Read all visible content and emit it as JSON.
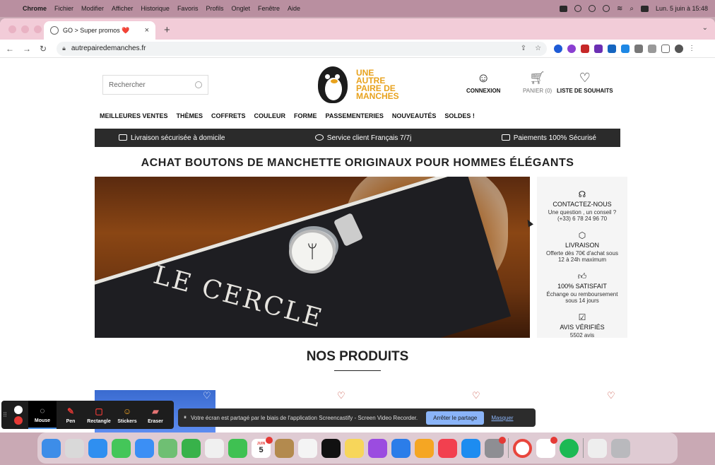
{
  "menubar": {
    "app": "Chrome",
    "items": [
      "Fichier",
      "Modifier",
      "Afficher",
      "Historique",
      "Favoris",
      "Profils",
      "Onglet",
      "Fenêtre",
      "Aide"
    ],
    "clock": "Lun. 5 juin à 15:48"
  },
  "browser": {
    "tab_title": "GO > Super promos ❤️",
    "url": "autrepairedemanches.fr",
    "new_tab": "+",
    "close": "×"
  },
  "site": {
    "search_placeholder": "Rechercher",
    "logo_text": "UNE AUTRE PAIRE DE MANCHES",
    "login": "CONNEXION",
    "cart": "PANIER (0)",
    "wishlist": "LISTE DE SOUHAITS",
    "menu": [
      "MEILLEURES VENTES",
      "THÈMES",
      "COFFRETS",
      "COULEUR",
      "FORME",
      "PASSEMENTERIES",
      "NOUVEAUTÉS",
      "SOLDES !"
    ],
    "banner": [
      "Livraison sécurisée à domicile",
      "Service client Français 7/7j",
      "Paiements 100% Sécurisé"
    ],
    "headline": "ACHAT BOUTONS DE MANCHETTE ORIGINAUX POUR HOMMES ÉLÉGANTS",
    "hero_text": "LE CERCLE",
    "info": [
      {
        "title": "CONTACTEZ-NOUS",
        "lines": [
          "Une question , un conseil ?",
          "(+33) 6 78 24 96 70"
        ]
      },
      {
        "title": "LIVRAISON",
        "lines": [
          "Offerte dès 70€ d'achat sous",
          "12 à 24h maximum"
        ]
      },
      {
        "title": "100% SATISFAIT",
        "lines": [
          "Échange ou remboursement",
          "sous 14 jours"
        ]
      },
      {
        "title": "AVIS VÉRIFIÉS",
        "lines": [
          "5502 avis"
        ]
      }
    ],
    "products_title": "NOS PRODUITS"
  },
  "screencastify": {
    "tools": [
      "Mouse",
      "Pen",
      "Rectangle",
      "Stickers",
      "Eraser"
    ],
    "share_text": "Votre écran est partagé par le biais de l'application Screencastify - Screen Video Recorder.",
    "stop_label": "Arrêter le partage",
    "hide_label": "Masquer"
  },
  "dock": {
    "calendar_month": "JUIN",
    "calendar_day": "5"
  }
}
